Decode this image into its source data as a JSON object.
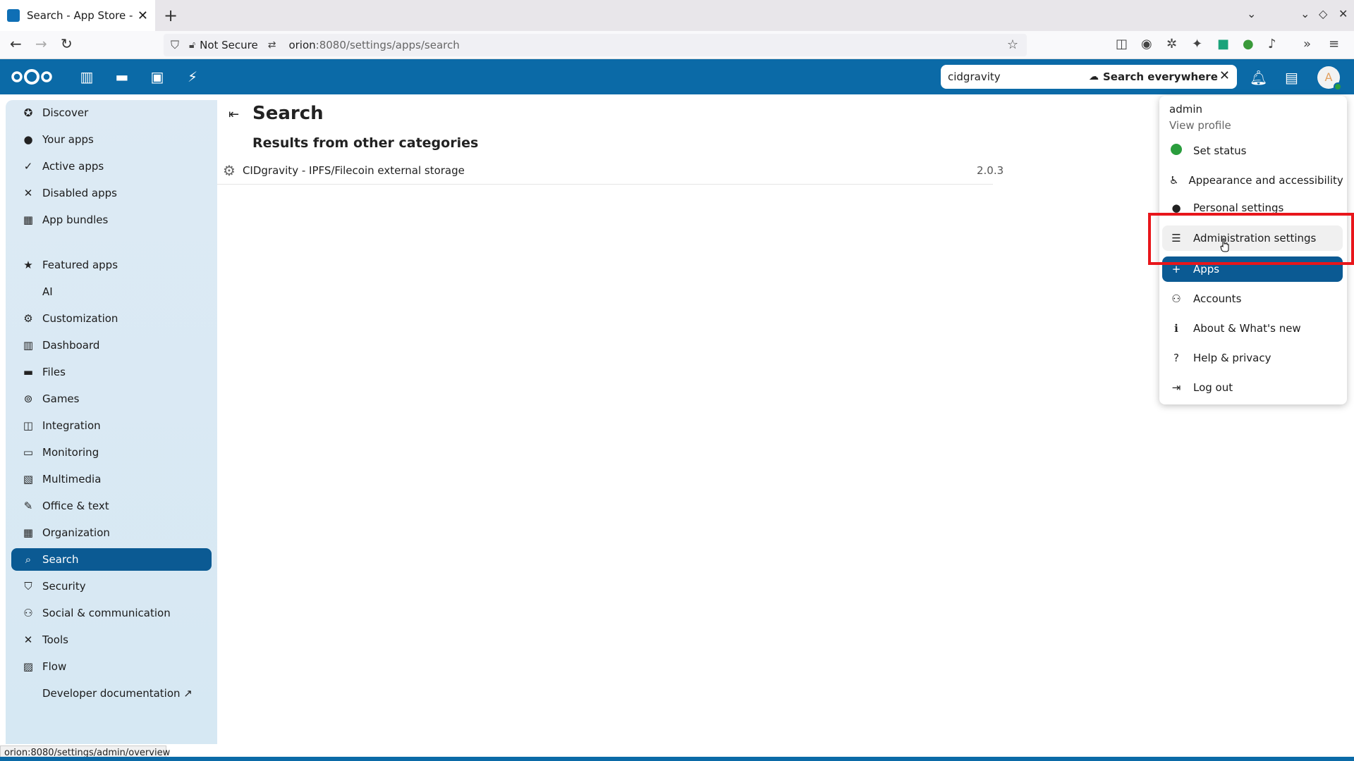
{
  "browser": {
    "tab_title": "Search - App Store - Nextcl",
    "new_tab_label": "+",
    "security_label": "Not Secure",
    "url_host": "orion",
    "url_path": ":8080/settings/apps/search",
    "status_url": "orion:8080/settings/admin/overview"
  },
  "header": {
    "search_value": "cidgravity",
    "search_scope_label": "Search everywhere",
    "avatar_letter": "A"
  },
  "sidebar": {
    "items": [
      {
        "label": "Discover",
        "icon": "compass-icon"
      },
      {
        "label": "Your apps",
        "icon": "person-icon"
      },
      {
        "label": "Active apps",
        "icon": "check-icon"
      },
      {
        "label": "Disabled apps",
        "icon": "close-icon"
      },
      {
        "label": "App bundles",
        "icon": "archive-icon"
      },
      {
        "label": "Featured apps",
        "icon": "star-icon"
      },
      {
        "label": "AI",
        "icon": ""
      },
      {
        "label": "Customization",
        "icon": "gear-icon"
      },
      {
        "label": "Dashboard",
        "icon": "dashboard-icon"
      },
      {
        "label": "Files",
        "icon": "folder-icon"
      },
      {
        "label": "Games",
        "icon": "gamepad-icon"
      },
      {
        "label": "Integration",
        "icon": "integration-icon"
      },
      {
        "label": "Monitoring",
        "icon": "monitor-icon"
      },
      {
        "label": "Multimedia",
        "icon": "multimedia-icon"
      },
      {
        "label": "Office & text",
        "icon": "document-edit-icon"
      },
      {
        "label": "Organization",
        "icon": "organization-icon"
      },
      {
        "label": "Search",
        "icon": "search-icon"
      },
      {
        "label": "Security",
        "icon": "shield-icon"
      },
      {
        "label": "Social & communication",
        "icon": "people-icon"
      },
      {
        "label": "Tools",
        "icon": "tools-icon"
      },
      {
        "label": "Flow",
        "icon": "flow-icon"
      },
      {
        "label": "Developer documentation ↗",
        "icon": ""
      }
    ]
  },
  "main": {
    "title": "Search",
    "subtitle": "Results from other categories",
    "results": [
      {
        "name": "CIDgravity - IPFS/Filecoin external storage",
        "version": "2.0.3"
      }
    ]
  },
  "user_menu": {
    "username": "admin",
    "view_profile": "View profile",
    "items": [
      {
        "label": "Set status",
        "icon": "status-dot-icon"
      },
      {
        "label": "Appearance and accessibility",
        "icon": "accessibility-icon"
      },
      {
        "label": "Personal settings",
        "icon": "person-icon"
      },
      {
        "label": "Administration settings",
        "icon": "tune-icon"
      },
      {
        "label": "Apps",
        "icon": "plus-icon"
      },
      {
        "label": "Accounts",
        "icon": "accounts-icon"
      },
      {
        "label": "About & What's new",
        "icon": "info-icon"
      },
      {
        "label": "Help & privacy",
        "icon": "help-icon"
      },
      {
        "label": "Log out",
        "icon": "logout-icon"
      }
    ]
  },
  "colors": {
    "brand": "#0b6aa7",
    "active": "#0b5a93",
    "highlight": "#e8161b",
    "status_online": "#2a9d3d"
  }
}
